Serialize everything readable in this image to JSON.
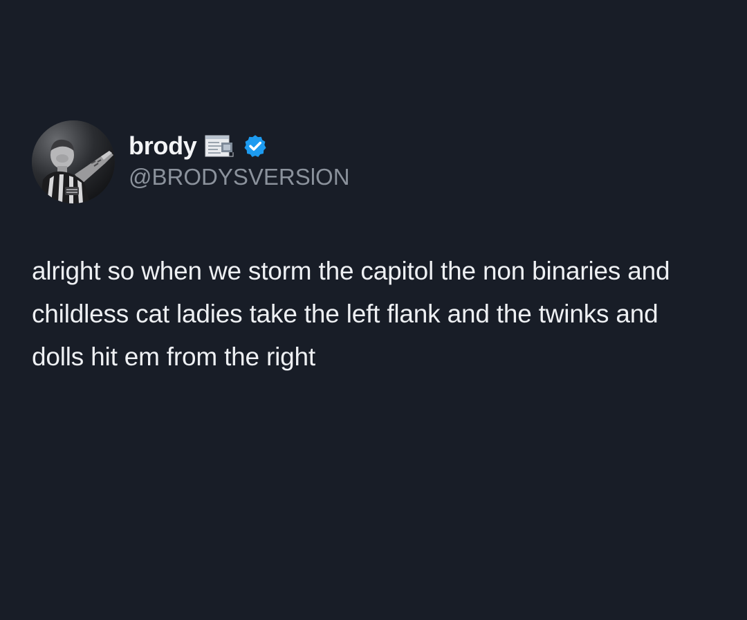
{
  "tweet": {
    "author": {
      "display_name": "brody",
      "handle": "@BRODYSVERSlON",
      "verified": true,
      "name_icons": [
        "document-icon",
        "verified-badge-icon"
      ],
      "verified_color": "#1d9bf0"
    },
    "text": "alright so when we storm the capitol the non binaries and childless cat ladies take the left flank and the twinks and dolls hit em from the right"
  },
  "theme": {
    "background": "#181d27",
    "text": "#eef0f3",
    "secondary_text": "#8b929c"
  }
}
